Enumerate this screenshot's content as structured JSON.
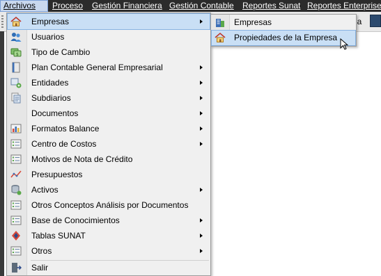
{
  "menubar": {
    "items": [
      "Archivos",
      "Proceso",
      "Gestión Financiera",
      "Gestión Contable",
      "Reportes Sunat",
      "Reportes Enterprise"
    ]
  },
  "toolbar": {
    "partial_text": "da"
  },
  "archivos_menu": {
    "items": [
      {
        "label": "Empresas",
        "icon": "house-icon",
        "submenu": true,
        "highlighted": true
      },
      {
        "label": "Usuarios",
        "icon": "users-icon",
        "submenu": false
      },
      {
        "label": "Tipo de Cambio",
        "icon": "exchange-icon",
        "submenu": false
      },
      {
        "label": "Plan Contable General Empresarial",
        "icon": "book-icon",
        "submenu": true
      },
      {
        "label": "Entidades",
        "icon": "entities-icon",
        "submenu": true
      },
      {
        "label": "Subdiarios",
        "icon": "ledger-icon",
        "submenu": true
      },
      {
        "label": "Documentos",
        "icon": "document-icon",
        "submenu": true
      },
      {
        "label": "Formatos Balance",
        "icon": "chart-icon",
        "submenu": true
      },
      {
        "label": "Centro de Costos",
        "icon": "list-icon",
        "submenu": true
      },
      {
        "label": "Motivos de Nota de Crédito",
        "icon": "list-icon",
        "submenu": false
      },
      {
        "label": "Presupuestos",
        "icon": "graph-icon",
        "submenu": false
      },
      {
        "label": "Activos",
        "icon": "database-icon",
        "submenu": true
      },
      {
        "label": "Otros Conceptos Análisis por Documentos",
        "icon": "list-icon",
        "submenu": false
      },
      {
        "label": "Base de Conocimientos",
        "icon": "list-icon",
        "submenu": true
      },
      {
        "label": "Tablas SUNAT",
        "icon": "sunat-icon",
        "submenu": true
      },
      {
        "label": "Otros",
        "icon": "list-icon",
        "submenu": true
      },
      {
        "label": "Salir",
        "icon": "exit-icon",
        "submenu": false
      }
    ]
  },
  "empresas_submenu": {
    "items": [
      {
        "label": "Empresas",
        "icon": "building-icon"
      },
      {
        "label": "Propiedades de la Empresa",
        "icon": "house-icon",
        "highlighted": true
      }
    ]
  },
  "colors": {
    "menubar_bg": "#2b2b2b",
    "highlight": "#c9dff5",
    "menu_bg": "#f0f0f0"
  }
}
